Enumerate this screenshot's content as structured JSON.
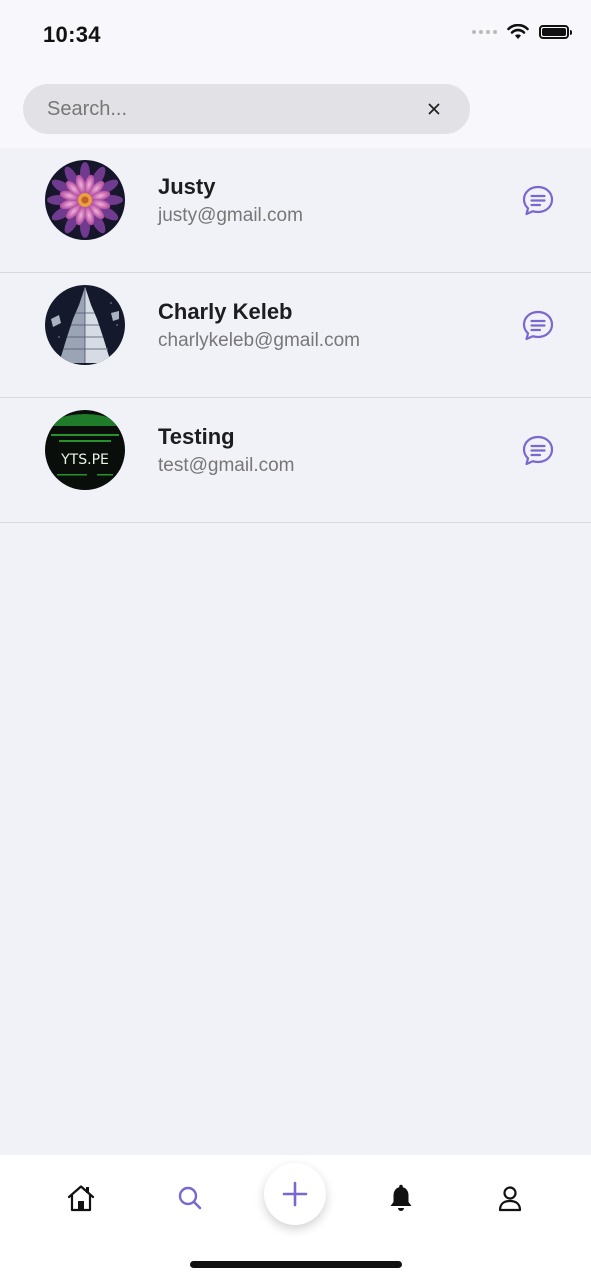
{
  "status_bar": {
    "time": "10:34"
  },
  "search": {
    "placeholder": "Search...",
    "value": ""
  },
  "contacts": [
    {
      "name": "Justy",
      "email": "justy@gmail.com",
      "avatar": "flower-photo"
    },
    {
      "name": "Charly Keleb",
      "email": "charlykeleb@gmail.com",
      "avatar": "tower-photo"
    },
    {
      "name": "Testing",
      "email": "test@gmail.com",
      "avatar": "yts-logo",
      "avatar_text": "YTS.PE"
    }
  ],
  "bottom_nav": {
    "items": [
      "home-icon",
      "search-icon",
      "add-icon",
      "bell-icon",
      "profile-icon"
    ],
    "active": "search-icon"
  },
  "colors": {
    "accent": "#7b68cf",
    "background": "#f1f2f8",
    "search_bg": "#e2e2e6"
  }
}
